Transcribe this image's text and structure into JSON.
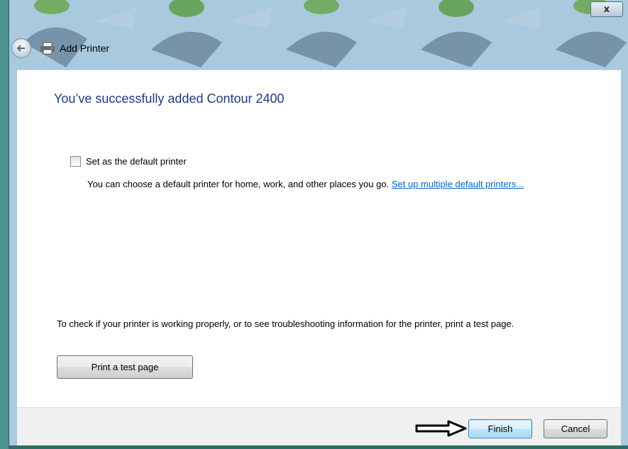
{
  "window": {
    "title": "Add Printer",
    "close_glyph": "x"
  },
  "icons": {
    "back": "back-arrow-icon",
    "printer": "printer-icon",
    "close": "close-icon",
    "pointer_arrow": "right-arrow-icon"
  },
  "main": {
    "heading": "You’ve successfully added Contour 2400",
    "default_printer": {
      "checked": false,
      "label": "Set as the default printer",
      "description": "You can choose a default printer for home, work, and other places you go.",
      "link": "Set up multiple default printers..."
    },
    "test_info": "To check if your printer is working properly, or to see troubleshooting information for the printer, print a test page.",
    "test_button": "Print a test page"
  },
  "footer": {
    "finish_label": "Finish",
    "cancel_label": "Cancel"
  },
  "colors": {
    "heading": "#1e3a8a",
    "link": "#0066cc",
    "default_button_border": "#3c7fb1"
  }
}
